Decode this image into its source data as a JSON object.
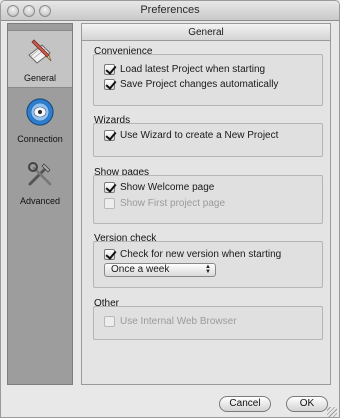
{
  "window": {
    "title": "Preferences"
  },
  "sidebar": {
    "items": [
      {
        "label": "General",
        "icon": "pencil-ruler-icon",
        "active": true
      },
      {
        "label": "Connection",
        "icon": "globe-network-icon",
        "active": false
      },
      {
        "label": "Advanced",
        "icon": "tools-icon",
        "active": false
      }
    ]
  },
  "panel": {
    "header": "General",
    "groups": [
      {
        "title": "Convenience",
        "items": [
          {
            "label": "Load latest Project when starting",
            "checked": true,
            "enabled": true
          },
          {
            "label": "Save Project changes automatically",
            "checked": true,
            "enabled": true
          }
        ]
      },
      {
        "title": "Wizards",
        "items": [
          {
            "label": "Use Wizard to create a New Project",
            "checked": true,
            "enabled": true
          }
        ]
      },
      {
        "title": "Show pages",
        "items": [
          {
            "label": "Show Welcome page",
            "checked": true,
            "enabled": true
          },
          {
            "label": "Show First project page",
            "checked": false,
            "enabled": false
          }
        ]
      },
      {
        "title": "Version check",
        "items": [
          {
            "label": "Check for new version when starting",
            "checked": true,
            "enabled": true
          }
        ],
        "frequency": {
          "selected": "Once a week"
        }
      },
      {
        "title": "Other",
        "items": [
          {
            "label": "Use Internal Web Browser",
            "checked": false,
            "enabled": false
          }
        ]
      }
    ]
  },
  "buttons": {
    "cancel": "Cancel",
    "ok": "OK"
  }
}
